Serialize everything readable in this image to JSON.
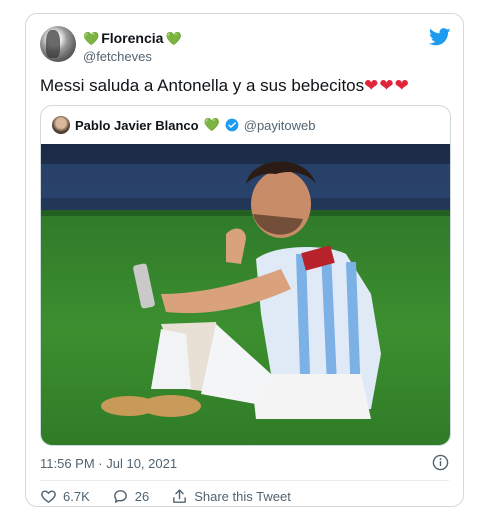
{
  "author": {
    "display_name": "Florencia",
    "name_prefix_emoji": "💚",
    "name_suffix_emoji": "💚",
    "handle": "@fetcheves",
    "avatar_icon": "profile-avatar"
  },
  "tweet": {
    "text": "Messi saluda a Antonella y a sus bebecitos",
    "trailing_emoji": "❤❤❤"
  },
  "quoted": {
    "display_name": "Pablo Javier Blanco",
    "name_emoji": "💚",
    "handle": "@payitoweb",
    "verified_icon": "verified-badge-icon",
    "image_icon": "photo-of-soccer-player-on-grass-with-phone"
  },
  "meta": {
    "timestamp": "11:56 PM · Jul 10, 2021"
  },
  "actions": {
    "likes": "6.7K",
    "replies": "26",
    "share_label": "Share this Tweet"
  },
  "colors": {
    "twitter_blue": "#1d9bf0",
    "green_heart": "#5fb04f",
    "red_heart": "#e0243a",
    "secondary_text": "#536471",
    "border": "#cfd9de"
  }
}
